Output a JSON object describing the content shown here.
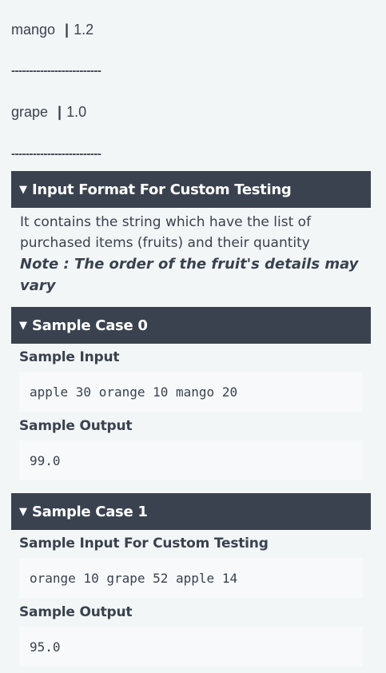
{
  "price_list": [
    {
      "fruit": "mango",
      "pipe": "|",
      "price": "1.2"
    },
    {
      "fruit": "grape",
      "pipe": "|",
      "price": "1.0"
    }
  ],
  "separator": "-------------------------",
  "input_format": {
    "header": "Input Format For Custom Testing",
    "caret": "▼",
    "description": "It contains the string which have the list of purchased items (fruits) and their quantity",
    "note": "Note : The order of the fruit's details may vary"
  },
  "sample_case_0": {
    "header": "Sample Case 0",
    "caret": "▼",
    "input_label": "Sample Input",
    "input_value": "apple 30 orange 10 mango 20",
    "output_label": "Sample Output",
    "output_value": "99.0"
  },
  "sample_case_1": {
    "header": "Sample Case 1",
    "caret": "▼",
    "input_label": "Sample Input For Custom Testing",
    "input_value": "orange 10 grape 52 apple 14",
    "output_label": "Sample Output",
    "output_value": "95.0"
  }
}
